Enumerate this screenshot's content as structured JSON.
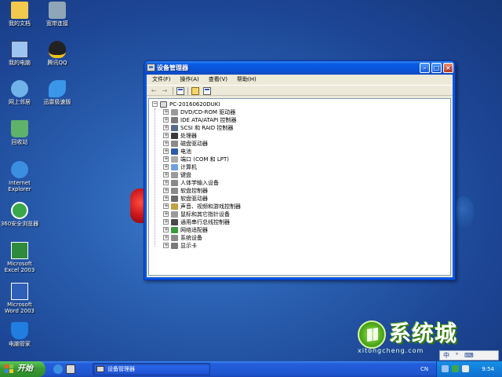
{
  "desktop": {
    "icons": [
      {
        "label": "我的文档",
        "icon": "my-documents-icon",
        "color": "#f2c94c"
      },
      {
        "label": "我的电脑",
        "icon": "my-computer-icon",
        "color": "#9dc3f0"
      },
      {
        "label": "网上邻居",
        "icon": "network-places-icon",
        "color": "#6fb3e8"
      },
      {
        "label": "回收站",
        "icon": "recycle-bin-icon",
        "color": "#5fb26a"
      },
      {
        "label": "Internet Explorer",
        "icon": "internet-explorer-icon",
        "color": "#3b8fe0"
      },
      {
        "label": "360安全浏览器",
        "icon": "360-browser-icon",
        "color": "#3aa84a"
      },
      {
        "label": "Microsoft Excel 2003",
        "icon": "excel-icon",
        "color": "#2e8b3d"
      },
      {
        "label": "Microsoft Word 2003",
        "icon": "word-icon",
        "color": "#2f5fb8"
      },
      {
        "label": "电脑管家",
        "icon": "pc-manager-icon",
        "color": "#1f7ee0"
      },
      {
        "label": "宽带连接",
        "icon": "broadband-icon",
        "color": "#8fa6b8"
      },
      {
        "label": "腾讯QQ",
        "icon": "qq-icon",
        "color": "#222222"
      },
      {
        "label": "迅雷极速版",
        "icon": "thunder-icon",
        "color": "#3a96e8"
      }
    ]
  },
  "window": {
    "title": "设备管理器",
    "menu": [
      "文件(F)",
      "操作(A)",
      "查看(V)",
      "帮助(H)"
    ],
    "toolbar": {
      "back": "←",
      "forward": "→"
    },
    "tree": {
      "root": "PC-20160620DUKI",
      "items": [
        {
          "label": "DVD/CD-ROM 驱动器",
          "icon": "dvd-drive-icon",
          "color": "#9a9a9a"
        },
        {
          "label": "IDE ATA/ATAPI 控制器",
          "icon": "ide-controller-icon",
          "color": "#7a7a7a"
        },
        {
          "label": "SCSI 和 RAID 控制器",
          "icon": "scsi-controller-icon",
          "color": "#5a6a8a"
        },
        {
          "label": "处理器",
          "icon": "processor-icon",
          "color": "#3a3a3a"
        },
        {
          "label": "磁盘驱动器",
          "icon": "disk-drive-icon",
          "color": "#8a8a8a"
        },
        {
          "label": "电池",
          "icon": "battery-icon",
          "color": "#2d5aa8"
        },
        {
          "label": "端口 (COM 和 LPT)",
          "icon": "port-icon",
          "color": "#aaaaaa"
        },
        {
          "label": "计算机",
          "icon": "computer-icon",
          "color": "#6fa0e0"
        },
        {
          "label": "键盘",
          "icon": "keyboard-icon",
          "color": "#9a9a9a"
        },
        {
          "label": "人体学输入设备",
          "icon": "hid-icon",
          "color": "#8a8a8a"
        },
        {
          "label": "软盘控制器",
          "icon": "floppy-controller-icon",
          "color": "#8a8a8a"
        },
        {
          "label": "软盘驱动器",
          "icon": "floppy-drive-icon",
          "color": "#6a6a6a"
        },
        {
          "label": "声音、视频和游戏控制器",
          "icon": "sound-icon",
          "color": "#c0a040"
        },
        {
          "label": "鼠标和其它指针设备",
          "icon": "mouse-icon",
          "color": "#9a9a9a"
        },
        {
          "label": "通用串行总线控制器",
          "icon": "usb-icon",
          "color": "#4a4a4a"
        },
        {
          "label": "网络适配器",
          "icon": "network-adapter-icon",
          "color": "#3a9a3a"
        },
        {
          "label": "系统设备",
          "icon": "system-devices-icon",
          "color": "#8a8a8a"
        },
        {
          "label": "显示卡",
          "icon": "display-adapter-icon",
          "color": "#7a7a7a"
        }
      ]
    }
  },
  "watermark": {
    "text": "系统城",
    "url": "xitongcheng.com"
  },
  "taskbar": {
    "start_label": "开始",
    "task_label": "设备管理器",
    "lang": "CN",
    "clock": "9:54"
  },
  "ime": {
    "items": [
      "中",
      "°",
      "⌨"
    ]
  },
  "colors": {
    "desktop": "#2a5fb0",
    "titlebar": "#0a5be5",
    "start": "#3a9b36",
    "taskbar": "#245edb"
  }
}
